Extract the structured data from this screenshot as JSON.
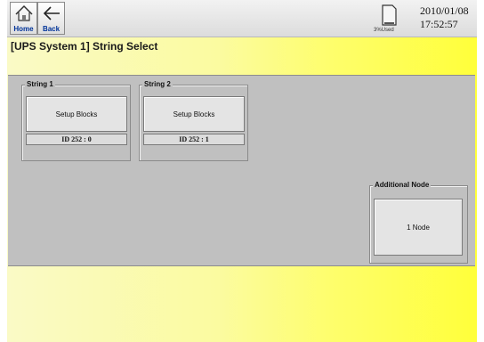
{
  "topbar": {
    "home_label": "Home",
    "back_label": "Back",
    "memory_label": "3%Used",
    "date": "2010/01/08",
    "time": "17:52:57"
  },
  "title": "[UPS System 1] String Select",
  "strings": [
    {
      "label": "String 1",
      "button_label": "Setup Blocks",
      "id_text": "ID 252 : 0"
    },
    {
      "label": "String 2",
      "button_label": "Setup Blocks",
      "id_text": "ID 252 : 1"
    }
  ],
  "additional_node": {
    "label": "Additional Node",
    "button_label": "1 Node"
  },
  "icons": {
    "home": "home-icon",
    "back": "arrow-left-icon",
    "memory": "memory-card-icon"
  },
  "colors": {
    "accent_text": "#003399",
    "panel_gray": "#c0c0c0",
    "background_yellow": "#ffff3a"
  }
}
